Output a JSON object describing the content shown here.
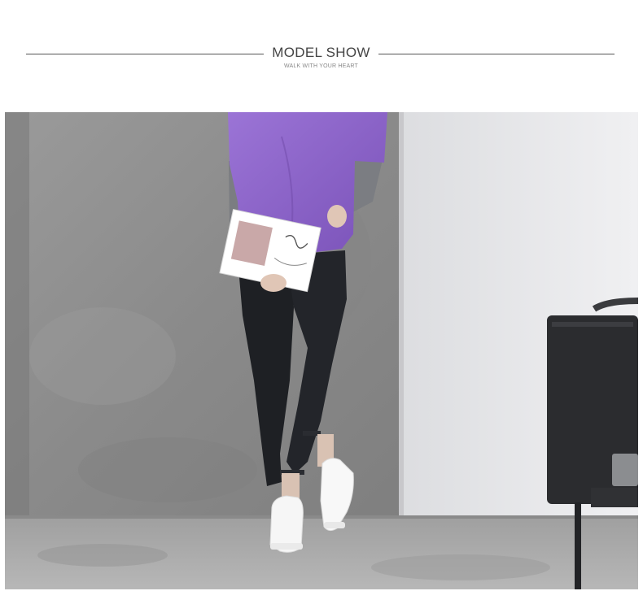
{
  "header": {
    "title": "MODEL SHOW",
    "subtitle": "WALK WITH YOUR HEART"
  },
  "photo": {
    "alt_subject": "model-in-purple-top-and-black-jeans-leaning-on-wall",
    "colors": {
      "concrete_wall": "#8f8f8f",
      "white_wall": "#e8e8ea",
      "floor": "#a9a9a9",
      "purple_top": "#8b63c6",
      "grey_sleeves": "#7b7d82",
      "jeans": "#1e2024",
      "sneakers": "#f4f4f4",
      "chair": "#2b2c2f"
    }
  }
}
